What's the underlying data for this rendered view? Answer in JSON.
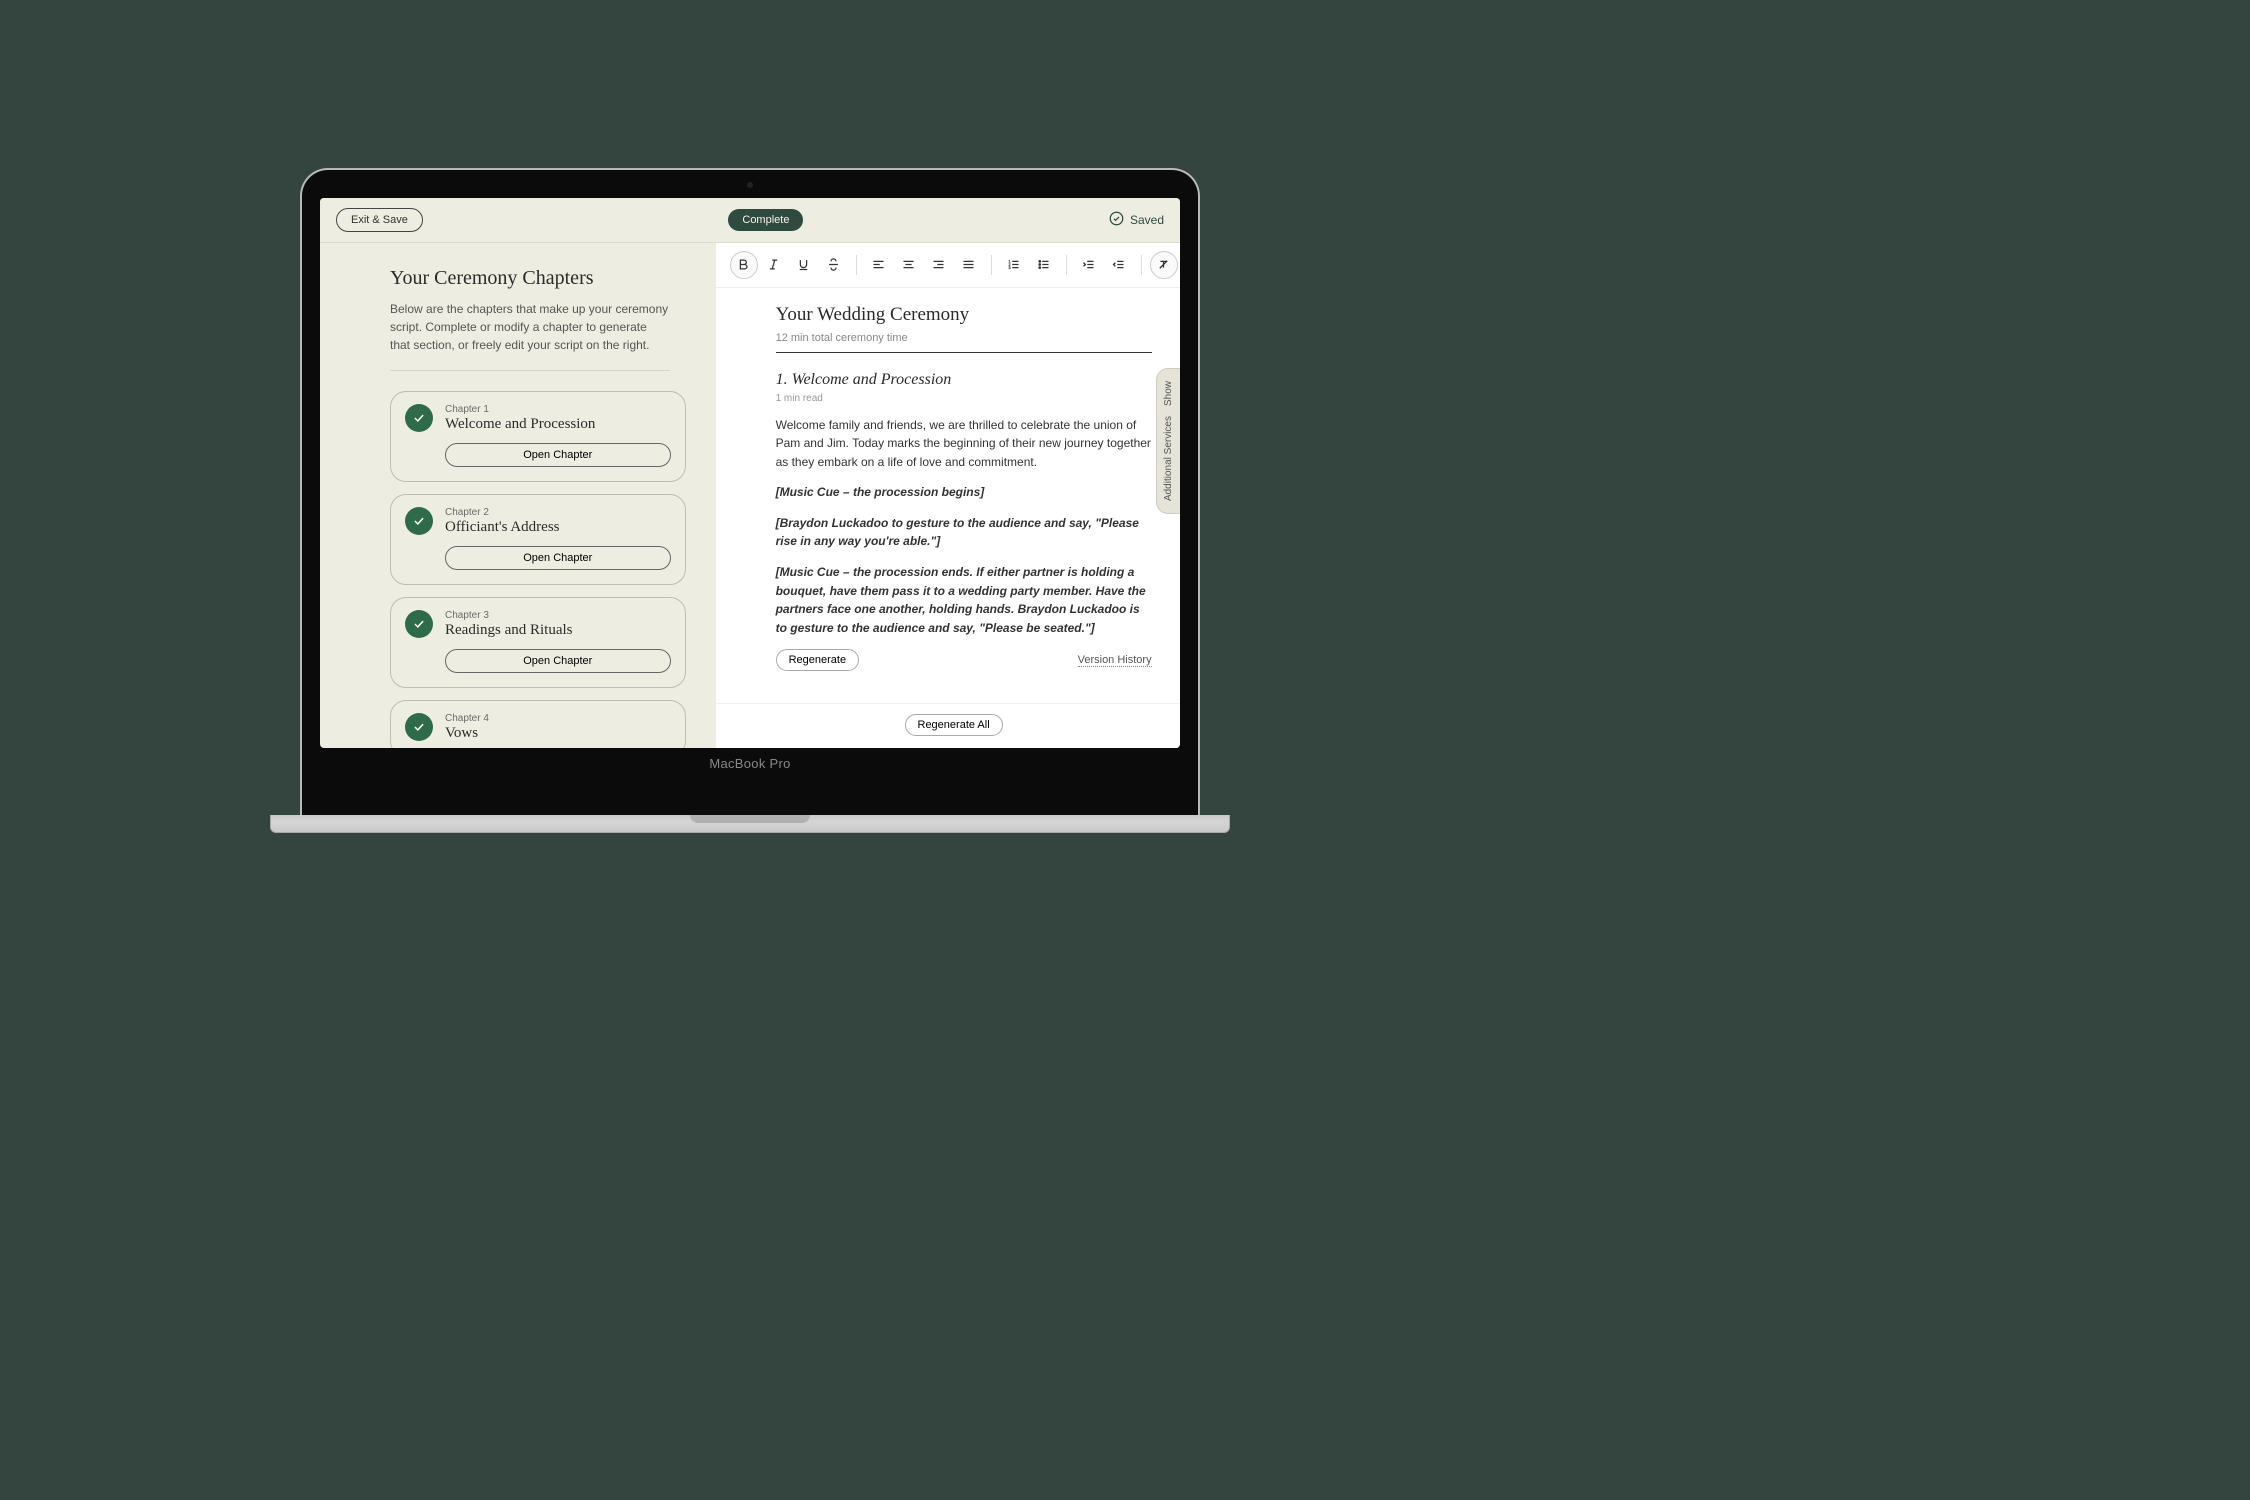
{
  "topbar": {
    "exit_label": "Exit & Save",
    "complete_label": "Complete",
    "saved_label": "Saved"
  },
  "left": {
    "heading": "Your Ceremony Chapters",
    "subtitle": "Below are the chapters that make up your ceremony script. Complete or modify a chapter to generate that section, or freely edit your script on the right.",
    "open_label": "Open Chapter",
    "chapters": [
      {
        "num": "Chapter 1",
        "title": "Welcome and Procession"
      },
      {
        "num": "Chapter 2",
        "title": "Officiant's Address"
      },
      {
        "num": "Chapter 3",
        "title": "Readings and Rituals"
      },
      {
        "num": "Chapter 4",
        "title": "Vows"
      }
    ]
  },
  "doc": {
    "title": "Your Wedding Ceremony",
    "meta": "12 min total ceremony time",
    "section_number": "1.",
    "section_title": "Welcome and Procession",
    "read_time": "1 min read",
    "p1": "Welcome family and friends, we are thrilled to celebrate the union of Pam and Jim. Today marks the beginning of their new journey together as they embark on a life of love and commitment.",
    "p2": "[Music Cue – the procession begins]",
    "p3": "[Braydon Luckadoo to gesture to the audience and say, \"Please rise in any way you're able.\"]",
    "p4": "[Music Cue – the procession ends. If either partner is holding a bouquet, have them pass it to a wedding party member. Have the partners face one another, holding hands. Braydon Luckadoo is to gesture to the audience and say, \"Please be seated.\"]",
    "regenerate": "Regenerate",
    "version_history": "Version History",
    "regenerate_all": "Regenerate All"
  },
  "side_tab": {
    "show": "Show",
    "label": "Additional Services"
  },
  "device": "MacBook Pro"
}
